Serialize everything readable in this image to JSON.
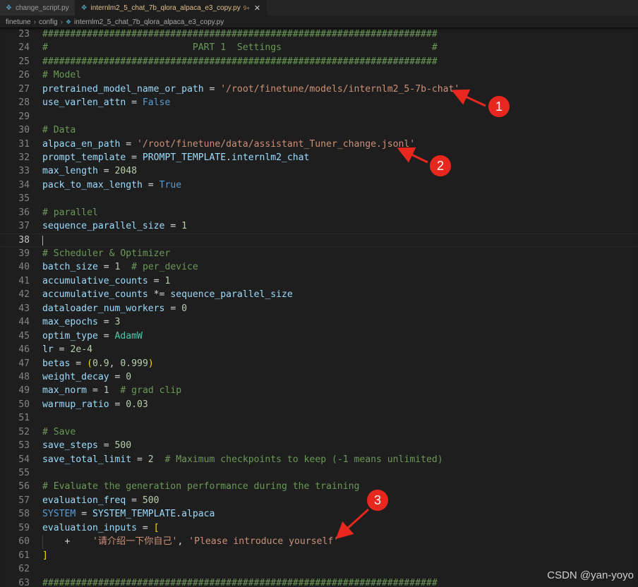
{
  "tabs": [
    {
      "label": "change_script.py",
      "active": false,
      "modified": ""
    },
    {
      "label": "internlm2_5_chat_7b_qlora_alpaca_e3_copy.py",
      "active": true,
      "modified": "9+"
    }
  ],
  "breadcrumb": [
    "finetune",
    "config",
    "internlm2_5_chat_7b_qlora_alpaca_e3_copy.py"
  ],
  "current_line": 38,
  "lines": [
    {
      "n": 23,
      "tokens": [
        [
          "c",
          "#######################################################################"
        ]
      ]
    },
    {
      "n": 24,
      "tokens": [
        [
          "c",
          "#                          PART 1  Settings                           #"
        ]
      ]
    },
    {
      "n": 25,
      "tokens": [
        [
          "c",
          "#######################################################################"
        ]
      ]
    },
    {
      "n": 26,
      "tokens": [
        [
          "c",
          "# Model"
        ]
      ]
    },
    {
      "n": 27,
      "tokens": [
        [
          "v",
          "pretrained_model_name_or_path"
        ],
        [
          "p",
          " = "
        ],
        [
          "s",
          "'/root/finetune/models/internlm2_5-7b-chat'"
        ]
      ]
    },
    {
      "n": 28,
      "tokens": [
        [
          "v",
          "use_varlen_attn"
        ],
        [
          "p",
          " = "
        ],
        [
          "k",
          "False"
        ]
      ]
    },
    {
      "n": 29,
      "tokens": []
    },
    {
      "n": 30,
      "tokens": [
        [
          "c",
          "# Data"
        ]
      ]
    },
    {
      "n": 31,
      "tokens": [
        [
          "v",
          "alpaca_en_path"
        ],
        [
          "p",
          " = "
        ],
        [
          "s",
          "'/root/finetune/data/assistant_Tuner_change.jsonl'"
        ]
      ]
    },
    {
      "n": 32,
      "tokens": [
        [
          "v",
          "prompt_template"
        ],
        [
          "p",
          " = "
        ],
        [
          "v",
          "PROMPT_TEMPLATE"
        ],
        [
          "p",
          "."
        ],
        [
          "v",
          "internlm2_chat"
        ]
      ]
    },
    {
      "n": 33,
      "tokens": [
        [
          "v",
          "max_length"
        ],
        [
          "p",
          " = "
        ],
        [
          "n",
          "2048"
        ]
      ]
    },
    {
      "n": 34,
      "tokens": [
        [
          "v",
          "pack_to_max_length"
        ],
        [
          "p",
          " = "
        ],
        [
          "k",
          "True"
        ]
      ]
    },
    {
      "n": 35,
      "tokens": []
    },
    {
      "n": 36,
      "tokens": [
        [
          "c",
          "# parallel"
        ]
      ]
    },
    {
      "n": 37,
      "tokens": [
        [
          "v",
          "sequence_parallel_size"
        ],
        [
          "p",
          " = "
        ],
        [
          "n",
          "1"
        ]
      ]
    },
    {
      "n": 38,
      "tokens": []
    },
    {
      "n": 39,
      "tokens": [
        [
          "c",
          "# Scheduler & Optimizer"
        ]
      ]
    },
    {
      "n": 40,
      "tokens": [
        [
          "v",
          "batch_size"
        ],
        [
          "p",
          " = "
        ],
        [
          "n",
          "1"
        ],
        [
          "p",
          "  "
        ],
        [
          "c",
          "# per_device"
        ]
      ]
    },
    {
      "n": 41,
      "tokens": [
        [
          "v",
          "accumulative_counts"
        ],
        [
          "p",
          " = "
        ],
        [
          "n",
          "1"
        ]
      ]
    },
    {
      "n": 42,
      "tokens": [
        [
          "v",
          "accumulative_counts"
        ],
        [
          "p",
          " *= "
        ],
        [
          "v",
          "sequence_parallel_size"
        ]
      ]
    },
    {
      "n": 43,
      "tokens": [
        [
          "v",
          "dataloader_num_workers"
        ],
        [
          "p",
          " = "
        ],
        [
          "n",
          "0"
        ]
      ]
    },
    {
      "n": 44,
      "tokens": [
        [
          "v",
          "max_epochs"
        ],
        [
          "p",
          " = "
        ],
        [
          "n",
          "3"
        ]
      ]
    },
    {
      "n": 45,
      "tokens": [
        [
          "v",
          "optim_type"
        ],
        [
          "p",
          " = "
        ],
        [
          "cls",
          "AdamW"
        ]
      ]
    },
    {
      "n": 46,
      "tokens": [
        [
          "v",
          "lr"
        ],
        [
          "p",
          " = "
        ],
        [
          "n",
          "2e-4"
        ]
      ]
    },
    {
      "n": 47,
      "tokens": [
        [
          "v",
          "betas"
        ],
        [
          "p",
          " = "
        ],
        [
          "y",
          "("
        ],
        [
          "n",
          "0.9"
        ],
        [
          "p",
          ", "
        ],
        [
          "n",
          "0.999"
        ],
        [
          "y",
          ")"
        ]
      ]
    },
    {
      "n": 48,
      "tokens": [
        [
          "v",
          "weight_decay"
        ],
        [
          "p",
          " = "
        ],
        [
          "n",
          "0"
        ]
      ]
    },
    {
      "n": 49,
      "tokens": [
        [
          "v",
          "max_norm"
        ],
        [
          "p",
          " = "
        ],
        [
          "n",
          "1"
        ],
        [
          "p",
          "  "
        ],
        [
          "c",
          "# grad clip"
        ]
      ]
    },
    {
      "n": 50,
      "tokens": [
        [
          "v",
          "warmup_ratio"
        ],
        [
          "p",
          " = "
        ],
        [
          "n",
          "0.03"
        ]
      ]
    },
    {
      "n": 51,
      "tokens": []
    },
    {
      "n": 52,
      "tokens": [
        [
          "c",
          "# Save"
        ]
      ]
    },
    {
      "n": 53,
      "tokens": [
        [
          "v",
          "save_steps"
        ],
        [
          "p",
          " = "
        ],
        [
          "n",
          "500"
        ]
      ]
    },
    {
      "n": 54,
      "tokens": [
        [
          "v",
          "save_total_limit"
        ],
        [
          "p",
          " = "
        ],
        [
          "n",
          "2"
        ],
        [
          "p",
          "  "
        ],
        [
          "c",
          "# Maximum checkpoints to keep (-1 means unlimited)"
        ]
      ]
    },
    {
      "n": 55,
      "tokens": []
    },
    {
      "n": 56,
      "tokens": [
        [
          "c",
          "# Evaluate the generation performance during the training"
        ]
      ]
    },
    {
      "n": 57,
      "tokens": [
        [
          "v",
          "evaluation_freq"
        ],
        [
          "p",
          " = "
        ],
        [
          "n",
          "500"
        ]
      ]
    },
    {
      "n": 58,
      "tokens": [
        [
          "k",
          "SYSTEM"
        ],
        [
          "p",
          " = "
        ],
        [
          "v",
          "SYSTEM_TEMPLATE"
        ],
        [
          "p",
          "."
        ],
        [
          "v",
          "alpaca"
        ]
      ]
    },
    {
      "n": 59,
      "tokens": [
        [
          "v",
          "evaluation_inputs"
        ],
        [
          "p",
          " = "
        ],
        [
          "y",
          "["
        ]
      ]
    },
    {
      "n": 60,
      "tokens": [
        [
          "p",
          "    +    "
        ],
        [
          "s",
          "'"
        ],
        [
          "cjk",
          "请介绍一下你自己"
        ],
        [
          "s",
          "'"
        ],
        [
          "p",
          ", "
        ],
        [
          "s",
          "'Please introduce yourself'"
        ]
      ]
    },
    {
      "n": 61,
      "tokens": [
        [
          "y",
          "]"
        ]
      ]
    },
    {
      "n": 62,
      "tokens": []
    },
    {
      "n": 63,
      "tokens": [
        [
          "c",
          "#######################################################################"
        ]
      ]
    }
  ],
  "annotations": [
    {
      "label": "1"
    },
    {
      "label": "2"
    },
    {
      "label": "3"
    }
  ],
  "colors": {
    "marker_fill": "#e8281e",
    "arrow": "#e8281e"
  },
  "watermark": "CSDN @yan-yoyo"
}
